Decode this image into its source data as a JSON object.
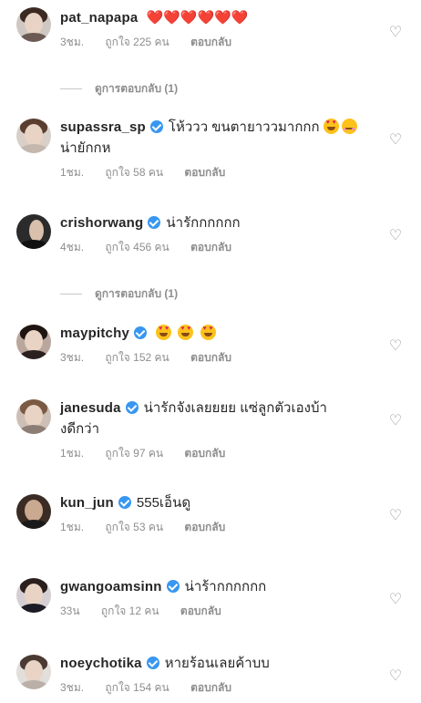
{
  "comments": [
    {
      "username": "pat_napapa",
      "verified": false,
      "text": "❤️❤️❤️❤️❤️❤️",
      "time": "3ชม.",
      "likes": "ถูกใจ 225 คน",
      "reply": "ตอบกลับ"
    },
    {
      "username": "supassra_sp",
      "verified": true,
      "text": "โห้ววว ขนตายาววมากกก",
      "text2": "น่ายักกห",
      "time": "1ชม.",
      "likes": "ถูกใจ 58 คน",
      "reply": "ตอบกลับ"
    },
    {
      "username": "crishorwang",
      "verified": true,
      "text": "น่ารักกกกกก",
      "time": "4ชม.",
      "likes": "ถูกใจ 456 คน",
      "reply": "ตอบกลับ"
    },
    {
      "username": "maypitchy",
      "verified": true,
      "text": "",
      "time": "3ชม.",
      "likes": "ถูกใจ 152 คน",
      "reply": "ตอบกลับ"
    },
    {
      "username": "janesuda",
      "verified": true,
      "text": "น่ารักจังเลยยยย แซ่ลูกตัวเองบ้า",
      "text2": "งดีกว่า",
      "time": "1ชม.",
      "likes": "ถูกใจ 97 คน",
      "reply": "ตอบกลับ"
    },
    {
      "username": "kun_jun",
      "verified": true,
      "text": "555เอ็นดู",
      "time": "1ชม.",
      "likes": "ถูกใจ 53 คน",
      "reply": "ตอบกลับ"
    },
    {
      "username": "gwangoamsinn",
      "verified": true,
      "text": "น่าร้ากกกกกก",
      "time": "33น",
      "likes": "ถูกใจ 12 คน",
      "reply": "ตอบกลับ"
    },
    {
      "username": "noeychotika",
      "verified": true,
      "text": "หายร้อนเลยค้าบบ",
      "time": "3ชม.",
      "likes": "ถูกใจ 154 คน",
      "reply": "ตอบกลับ"
    }
  ],
  "view_replies": "ดูการตอบกลับ (1)",
  "icons": {
    "like": "heart-outline-icon",
    "verified": "verified-badge-icon"
  },
  "colors": {
    "verified": "#3897f0",
    "meta": "#8e8e8e",
    "heart": "#ed4956"
  }
}
